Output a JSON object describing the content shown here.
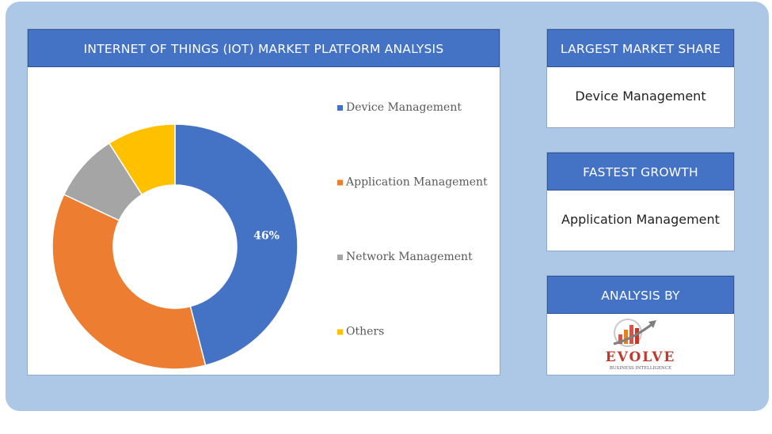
{
  "chart_header": "INTERNET OF THINGS (IOT) MARKET PLATFORM ANALYSIS",
  "chart_data": {
    "type": "pie",
    "donut": true,
    "categories": [
      "Device Management",
      "Application Management",
      "Network Management",
      "Others"
    ],
    "values": [
      46,
      36,
      9,
      9
    ],
    "colors": [
      "#4472c4",
      "#ed7d31",
      "#a5a5a5",
      "#ffc000"
    ],
    "data_labels": [
      "46%",
      "",
      "",
      ""
    ],
    "legend_position": "right"
  },
  "largest_share": {
    "title": "LARGEST MARKET SHARE",
    "value": "Device Management"
  },
  "fastest_growth": {
    "title": "FASTEST GROWTH",
    "value": "Application Management"
  },
  "analysis_by": {
    "title": "ANALYSIS BY",
    "logo_text": "EVOLVE",
    "logo_subtext": "BUSINESS INTELLIGENCE",
    "logo_color": "#c0392b"
  }
}
